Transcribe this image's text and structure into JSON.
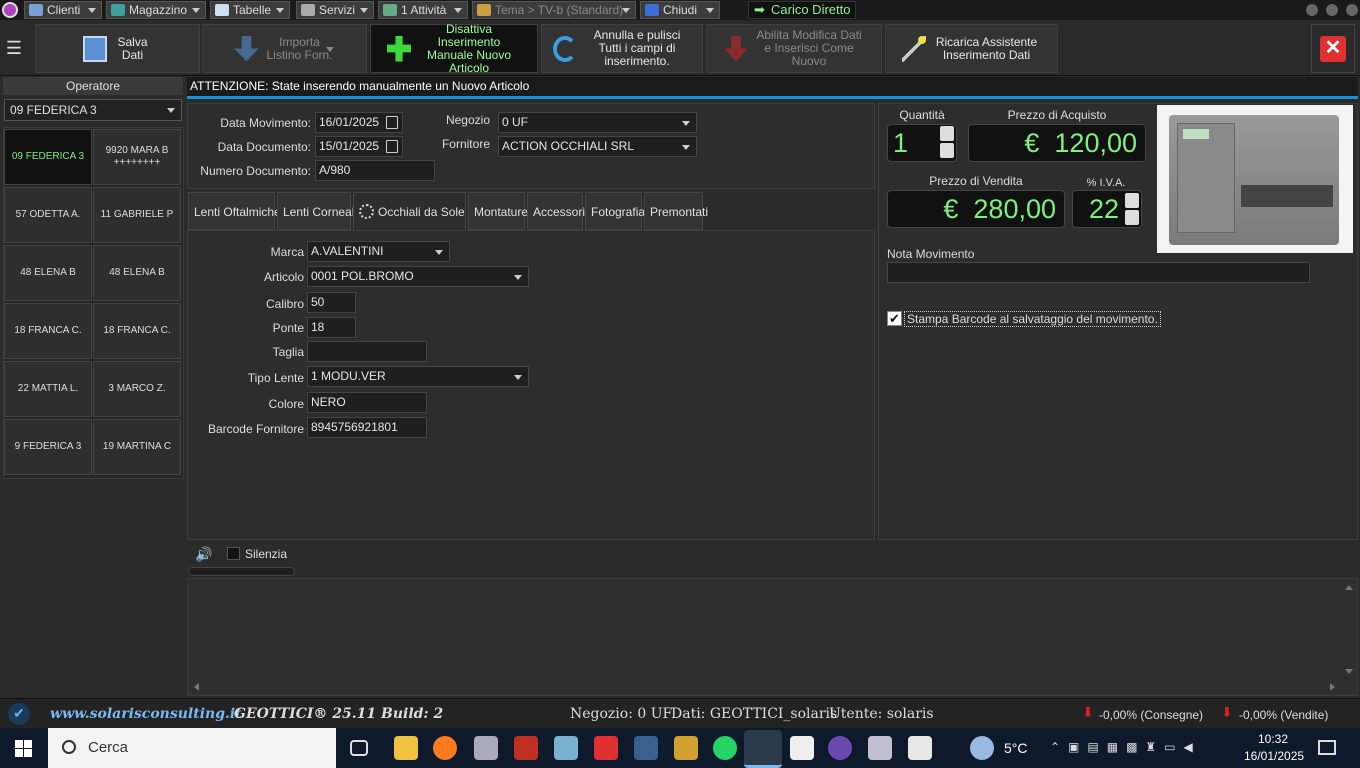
{
  "menubar": {
    "items": [
      {
        "label": "Clienti",
        "icon": "people-icon",
        "color": "#7a9fd6"
      },
      {
        "label": "Magazzino",
        "icon": "warehouse-icon",
        "color": "#3fa0a0"
      },
      {
        "label": "Tabelle",
        "icon": "table-icon",
        "color": "#cfe0f0"
      },
      {
        "label": "Servizi",
        "icon": "services-icon",
        "color": "#d0d0d0"
      },
      {
        "label": "1 Attività",
        "icon": "activity-icon",
        "color": "#6a8"
      },
      {
        "label": "Tema > TV-b (Standard)",
        "icon": "tag-icon",
        "color": "#c8a040"
      },
      {
        "label": "Chiudi",
        "icon": "exit-icon",
        "color": "#3a6fd8"
      }
    ],
    "carico": "Carico Diretto"
  },
  "toolbar": {
    "salva": "Salva Dati",
    "importa": "Importa Listino Forn.",
    "disattiva": "Disattiva Inserimento Manuale Nuovo Articolo",
    "annulla": "Annulla e pulisci Tutti i campi di inserimento.",
    "abilita": "Abilita Modifica Dati e Inserisci Come Nuovo",
    "ricarica": "Ricarica Assistente Inserimento Dati"
  },
  "operator": {
    "label": "Operatore",
    "selected": "09 FEDERICA 3",
    "buttons": [
      "09 FEDERICA 3",
      "9920 MARA B ++++++++",
      "57 ODETTA A.",
      "11 GABRIELE P",
      "48 ELENA B",
      "48 ELENA B",
      "18 FRANCA C.",
      "18 FRANCA C.",
      "22 MATTIA L.",
      "3 MARCO Z.",
      "9 FEDERICA 3",
      "19 MARTINA C"
    ]
  },
  "banner": "ATTENZIONE: State inserendo manualmente un Nuovo Articolo",
  "header_form": {
    "data_movimento_label": "Data Movimento:",
    "data_movimento": "16/01/2025",
    "data_documento_label": "Data Documento:",
    "data_documento": "15/01/2025",
    "numero_documento_label": "Numero Documento:",
    "numero_documento": "A/980",
    "negozio_label": "Negozio",
    "negozio": "0 UF",
    "fornitore_label": "Fornitore",
    "fornitore": "ACTION OCCHIALI SRL"
  },
  "tabs": [
    "Lenti Oftalmiche",
    "Lenti Corneali",
    "Occhiali da Sole",
    "Montature",
    "Accessori",
    "Fotografia",
    "Premontati"
  ],
  "article": {
    "marca_label": "Marca",
    "marca": "A.VALENTINI",
    "articolo_label": "Articolo",
    "articolo": "0001 POL.BROMO",
    "calibro_label": "Calibro",
    "calibro": "50",
    "ponte_label": "Ponte",
    "ponte": "18",
    "taglia_label": "Taglia",
    "taglia": "",
    "tipo_lente_label": "Tipo Lente",
    "tipo_lente": "1 MODU.VER",
    "colore_label": "Colore",
    "colore": "NERO",
    "barcode_label": "Barcode Fornitore",
    "barcode": "8945756921801"
  },
  "prices": {
    "quantita_label": "Quantità",
    "quantita": "1",
    "acquisto_label": "Prezzo di Acquisto",
    "acquisto": "€  120,00",
    "vendita_label": "Prezzo di Vendita",
    "vendita": "€  280,00",
    "iva_label": "% I.V.A.",
    "iva": "22",
    "nota_label": "Nota Movimento",
    "nota": "",
    "stampa_label": "Stampa Barcode al salvataggio del movimento."
  },
  "log": {
    "silenzia": "Silenzia"
  },
  "status": {
    "site": "www.solarisconsulting.it",
    "app": "GEOTTICI® 25.11 Build: 2",
    "negozio": "Negozio: 0 UF",
    "dati": "Dati: GEOTTICI_solaris",
    "utente": "Utente: solaris",
    "consegne": "-0,00% (Consegne)",
    "vendite": "-0,00% (Vendite)"
  },
  "taskbar": {
    "search": "Cerca",
    "weather": "5°C",
    "time": "10:32",
    "date": "16/01/2025"
  }
}
